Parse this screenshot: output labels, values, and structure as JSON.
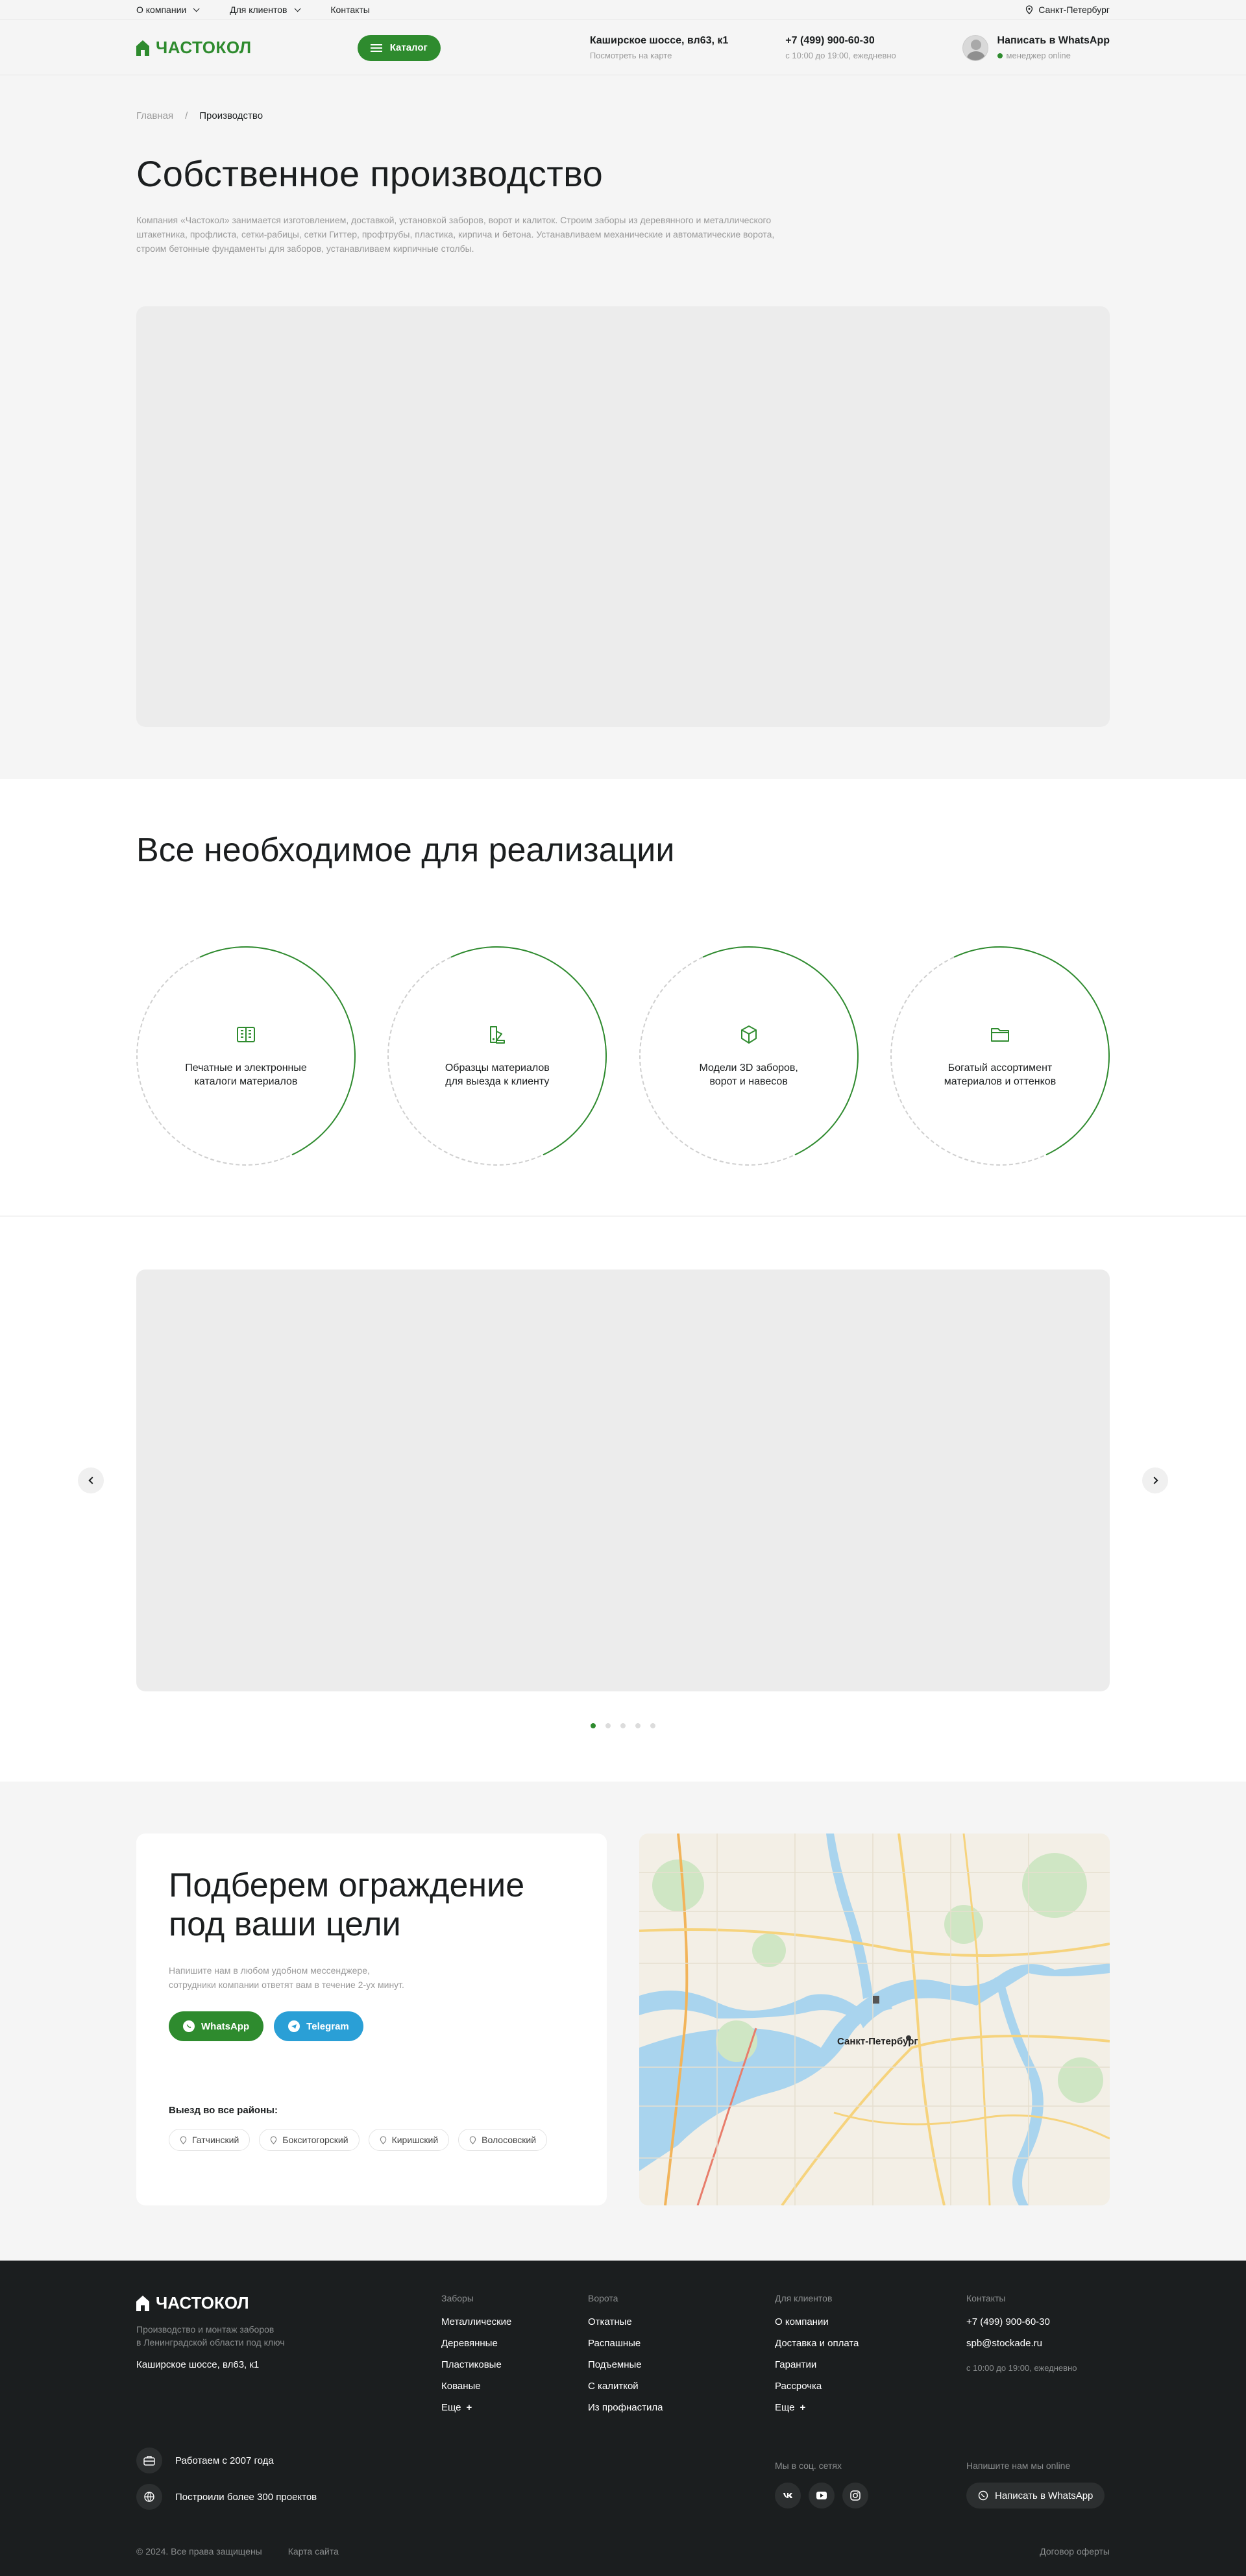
{
  "topbar": {
    "nav": [
      "О компании",
      "Для клиентов",
      "Контакты"
    ],
    "city": "Санкт-Петербург"
  },
  "header": {
    "logo": "ЧАСТОКОЛ",
    "catalog": "Каталог",
    "address": "Каширское шоссе, вл63, к1",
    "address_sub": "Посмотреть на карте",
    "phone": "+7 (499) 900-60-30",
    "hours": "с 10:00 до 19:00, ежедневно",
    "whatsapp": "Написать в WhatsApp",
    "manager": "менеджер online"
  },
  "breadcrumbs": {
    "home": "Главная",
    "sep": "/",
    "current": "Производство"
  },
  "page": {
    "title": "Собственное производство",
    "intro": "Компания «Частокол» занимается изготовлением, доставкой, установкой заборов, ворот и калиток. Строим заборы из деревянного и металлического штакетника, профлиста, сетки-рабицы, сетки Гиттер, профтрубы, пластика, кирпича и бетона. Устанавливаем механические и автоматические ворота, строим бетонные фундаменты для заборов, устанавливаем кирпичные столбы."
  },
  "features": {
    "title": "Все необходимое для реализации",
    "items": [
      {
        "icon": "catalog-icon",
        "text1": "Печатные и электронные",
        "text2": "каталоги материалов"
      },
      {
        "icon": "samples-icon",
        "text1": "Образцы материалов",
        "text2": "для выезда к клиенту"
      },
      {
        "icon": "cube-3d-icon",
        "text1": "Модели 3D заборов,",
        "text2": "ворот и навесов"
      },
      {
        "icon": "folder-icon",
        "text1": "Богатый ассортимент",
        "text2": "материалов и оттенков"
      }
    ]
  },
  "slider": {
    "slides": 5,
    "active": 1
  },
  "contact": {
    "title1": "Подберем ограждение",
    "title2": "под ваши цели",
    "desc1": "Напишите нам в любом удобном мессенджере,",
    "desc2": "сотрудники компании ответят вам в течение 2-ух минут.",
    "whatsapp": "WhatsApp",
    "telegram": "Telegram",
    "districts_title": "Выезд во все районы:",
    "districts": [
      "Гатчинский",
      "Бокситогорский",
      "Киришский",
      "Волосовский"
    ],
    "map_city": "Санкт-Петербург"
  },
  "footer": {
    "logo": "ЧАСТОКОЛ",
    "tagline1": "Производство и монтаж заборов",
    "tagline2": "в Ленинградской области под ключ",
    "address": "Каширское шоссе, вл63, к1",
    "columns": [
      {
        "title": "Заборы",
        "items": [
          "Металлические",
          "Деревянные",
          "Пластиковые",
          "Кованые",
          "Еще"
        ]
      },
      {
        "title": "Ворота",
        "items": [
          "Откатные",
          "Распашные",
          "Подъемные",
          "С калиткой",
          "Из профнастила"
        ]
      },
      {
        "title": "Для клиентов",
        "items": [
          "О компании",
          "Доставка и оплата",
          "Гарантии",
          "Рассрочка",
          "Еще"
        ]
      }
    ],
    "contacts_title": "Контакты",
    "phone": "+7 (499) 900-60-30",
    "email": "spb@stockade.ru",
    "hours": "с 10:00 до 19:00, ежедневно",
    "facts": [
      "Работаем с 2007 года",
      "Построили более 300 проектов"
    ],
    "social_title": "Мы в соц. сетях",
    "online_title": "Напишите нам мы online",
    "whatsapp": "Написать в WhatsApp",
    "copyright": "© 2024. Все права защищены",
    "sitemap": "Карта сайта",
    "offer": "Договор оферты"
  },
  "colors": {
    "brand": "#2e8b2e",
    "telegram": "#2a9fd6",
    "footer_bg": "#1b1e1f",
    "page_bg": "#f5f5f5"
  }
}
